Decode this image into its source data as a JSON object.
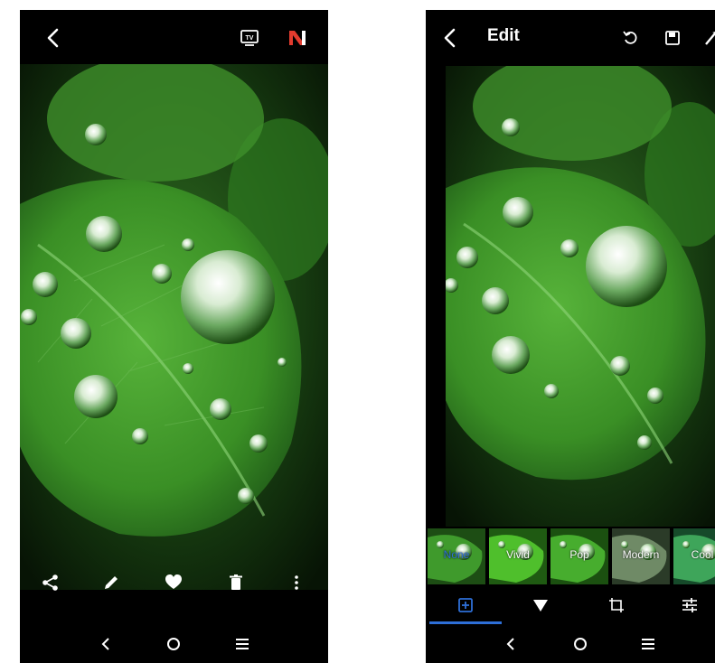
{
  "left_screen": {
    "top_icons": [
      "back-arrow-icon",
      "tv-cast-icon",
      "app-logo-icon"
    ],
    "tv_badge": "TV",
    "actions": [
      "share-icon",
      "pencil-edit-icon",
      "heart-icon",
      "trash-icon",
      "more-vert-icon"
    ],
    "nav": [
      "back-nav-icon",
      "home-nav-icon",
      "menu-nav-icon"
    ]
  },
  "right_screen": {
    "title": "Edit",
    "top_icons": [
      "back-arrow-icon",
      "undo-icon",
      "save-icon",
      "magic-wand-icon"
    ],
    "filters": [
      {
        "label": "None",
        "selected": true
      },
      {
        "label": "Vivid",
        "selected": false
      },
      {
        "label": "Pop",
        "selected": false
      },
      {
        "label": "Modern",
        "selected": false
      },
      {
        "label": "Cool",
        "selected": false
      }
    ],
    "tools": [
      "frame-add-icon",
      "filter-triangle-icon",
      "crop-rotate-icon",
      "adjust-sliders-icon"
    ],
    "nav": [
      "back-nav-icon",
      "home-nav-icon",
      "menu-nav-icon"
    ]
  },
  "colors": {
    "background": "#000000",
    "accent": "#2e6fd8",
    "logo_red": "#e23b2e",
    "leaf_green": "#3f9a2c"
  }
}
